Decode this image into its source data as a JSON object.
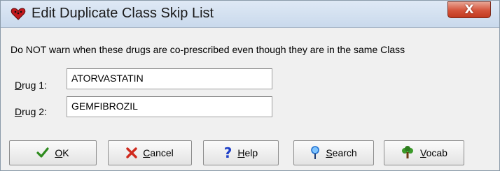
{
  "window": {
    "title": "Edit Duplicate Class Skip List",
    "close_glyph": "X"
  },
  "message": "Do NOT warn when these drugs are co-prescribed even though they are in the same Class",
  "drug1": {
    "label_accel": "D",
    "label_rest": "rug 1:",
    "value": "ATORVASTATIN"
  },
  "drug2": {
    "label_accel": "D",
    "label_rest": "rug 2:",
    "value": "GEMFIBROZIL"
  },
  "buttons": {
    "ok": {
      "accel": "O",
      "rest": "K",
      "icon": "checkmark-icon",
      "color": "#2e8b1e"
    },
    "cancel": {
      "accel": "C",
      "rest": "ancel",
      "icon": "x-icon",
      "color": "#d02a1e"
    },
    "help": {
      "accel": "H",
      "rest": "elp",
      "icon": "question-icon",
      "color": "#1e3fc8"
    },
    "search": {
      "accel": "S",
      "rest": "earch",
      "icon": "pin-icon",
      "color": "#1e6fd0"
    },
    "vocab": {
      "accel": "V",
      "rest": "ocab",
      "icon": "tree-icon",
      "color": "#2e7d1e"
    }
  }
}
